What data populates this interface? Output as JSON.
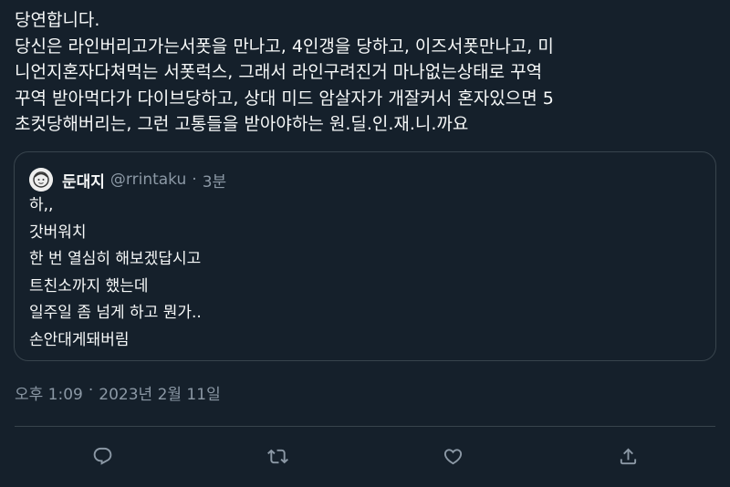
{
  "tweet": {
    "lines": [
      "당연합니다.",
      "당신은 라인버리고가는서폿을 만나고, 4인갱을 당하고, 이즈서폿만나고, 미",
      "니언지혼자다쳐먹는 서폿럭스, 그래서 라인구려진거 마나없는상태로 꾸역",
      "꾸역 받아먹다가 다이브당하고, 상대 미드 암살자가 개잘커서 혼자있으면 5",
      "초컷당해버리는, 그런 고통들을 받아야하는 원.딜.인.재.니.까요"
    ]
  },
  "quote": {
    "display_name": "둔대지",
    "handle": "@rrintaku",
    "separator": "·",
    "time": "3분",
    "lines": [
      "하,,",
      "갓버워치",
      "한 번 열심히 해보겠답시고",
      "트친소까지 했는데",
      "일주일 좀 넘게 하고 뭔가..",
      "손안대게돼버림"
    ]
  },
  "timestamp": {
    "time": "오후 1:09",
    "separator": "·",
    "date": "2023년 2월 11일"
  },
  "actions": {
    "icons": [
      "reply-icon",
      "retweet-icon",
      "like-icon",
      "share-icon"
    ],
    "icon_color": "#8b98a5"
  },
  "colors": {
    "background": "#15202b",
    "text": "#f7f9f9",
    "secondary": "#8b98a5",
    "border": "#38444d"
  }
}
